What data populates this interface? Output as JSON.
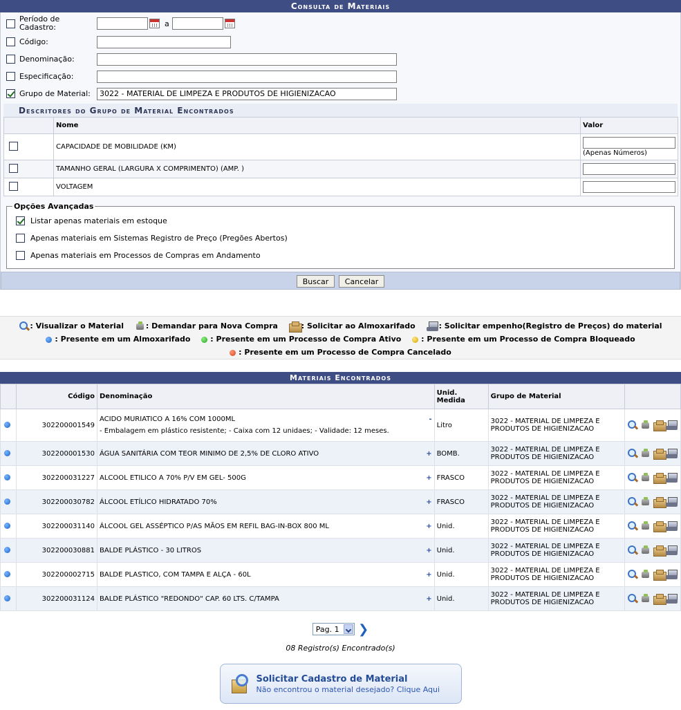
{
  "consulta": {
    "title": "Consulta de Materiais",
    "periodo_label": "Período de Cadastro:",
    "periodo_sep": "a",
    "codigo_label": "Código:",
    "denominacao_label": "Denominação:",
    "especificacao_label": "Especificação:",
    "grupo_label": "Grupo de Material:",
    "grupo_value": "3022 - MATERIAL DE LIMPEZA E PRODUTOS DE HIGIENIZACAO"
  },
  "descritores": {
    "title": "Descritores do Grupo de Material Encontrados",
    "col_nome": "Nome",
    "col_valor": "Valor",
    "rows": [
      {
        "nome": "CAPACIDADE DE MOBILIDADE (KM)",
        "hint": "(Apenas Números)"
      },
      {
        "nome": "TAMANHO GERAL (LARGURA X COMPRIMENTO) (AMP. )",
        "hint": ""
      },
      {
        "nome": "VOLTAGEM",
        "hint": ""
      }
    ]
  },
  "avancadas": {
    "legend": "Opções Avançadas",
    "opt1": "Listar apenas materiais em estoque",
    "opt2": "Apenas materiais em Sistemas Registro de Preço (Pregões Abertos)",
    "opt3": "Apenas materiais em Processos de Compras em Andamento"
  },
  "buttons": {
    "buscar": "Buscar",
    "cancelar": "Cancelar"
  },
  "legend": {
    "visualizar": ": Visualizar o Material",
    "demandar": ": Demandar para Nova Compra",
    "solicitar": ": Solicitar ao Almoxarifado",
    "empenho": ": Solicitar empenho(Registro de Preços) do material",
    "almox": ": Presente em um Almoxarifado",
    "ativo": ": Presente em um Processo de Compra Ativo",
    "bloqueado": ": Presente em um Processo de Compra Bloqueado",
    "cancelado": ": Presente em um Processo de Compra Cancelado"
  },
  "materiais": {
    "title": "Materiais Encontrados",
    "col_codigo": "Código",
    "col_denominacao": "Denominação",
    "col_unid": "Unid. Medida",
    "col_grupo": "Grupo de Material",
    "rows": [
      {
        "codigo": "302200001549",
        "den": "ACIDO MURIATICO A 16% COM 1000ML",
        "toggle": "-",
        "spec": "- Embalagem em plástico resistente; - Caixa com 12 unidaes; - Validade: 12 meses.",
        "unid": "Litro",
        "grupo": "3022 - MATERIAL DE LIMPEZA E PRODUTOS DE HIGIENIZACAO"
      },
      {
        "codigo": "302200001530",
        "den": "ÁGUA SANITÁRIA COM TEOR MINIMO DE 2,5% DE CLORO ATIVO",
        "toggle": "+",
        "spec": "",
        "unid": "BOMB.",
        "grupo": "3022 - MATERIAL DE LIMPEZA E PRODUTOS DE HIGIENIZACAO"
      },
      {
        "codigo": "302200031227",
        "den": "ALCOOL ETILICO A 70% P/V EM GEL- 500G",
        "toggle": "+",
        "spec": "",
        "unid": "FRASCO",
        "grupo": "3022 - MATERIAL DE LIMPEZA E PRODUTOS DE HIGIENIZACAO"
      },
      {
        "codigo": "302200030782",
        "den": "ÁLCOOL ETÍLICO HIDRATADO 70%",
        "toggle": "+",
        "spec": "",
        "unid": "FRASCO",
        "grupo": "3022 - MATERIAL DE LIMPEZA E PRODUTOS DE HIGIENIZACAO"
      },
      {
        "codigo": "302200031140",
        "den": "ÁLCOOL GEL ASSÉPTICO P/AS MÃOS EM REFIL BAG-IN-BOX 800 ML",
        "toggle": "+",
        "spec": "",
        "unid": "Unid.",
        "grupo": "3022 - MATERIAL DE LIMPEZA E PRODUTOS DE HIGIENIZACAO"
      },
      {
        "codigo": "302200030881",
        "den": "BALDE PLÁSTICO - 30 LITROS",
        "toggle": "+",
        "spec": "",
        "unid": "Unid.",
        "grupo": "3022 - MATERIAL DE LIMPEZA E PRODUTOS DE HIGIENIZACAO"
      },
      {
        "codigo": "302200002715",
        "den": "BALDE PLASTICO, COM TAMPA E ALÇA - 60L",
        "toggle": "+",
        "spec": "",
        "unid": "Unid.",
        "grupo": "3022 - MATERIAL DE LIMPEZA E PRODUTOS DE HIGIENIZACAO"
      },
      {
        "codigo": "302200031124",
        "den": "BALDE PLÁSTICO \"REDONDO\" CAP. 60 LTS. C/TAMPA",
        "toggle": "+",
        "spec": "",
        "unid": "Unid.",
        "grupo": "3022 - MATERIAL DE LIMPEZA E PRODUTOS DE HIGIENIZACAO"
      }
    ]
  },
  "pager": {
    "page": "Pag. 1",
    "count": "08 Registro(s) Encontrado(s)"
  },
  "solicitar": {
    "title": "Solicitar Cadastro de Material",
    "subtitle": "Não encontrou o material desejado? Clique Aqui"
  }
}
